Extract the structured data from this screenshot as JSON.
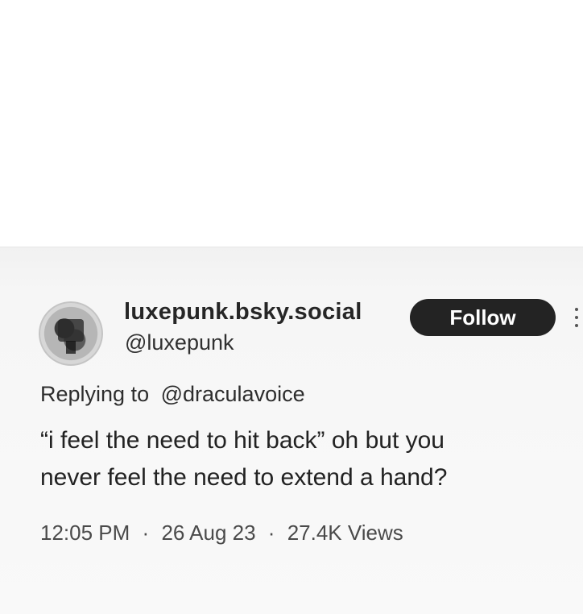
{
  "profile": {
    "display_name": "luxepunk.bsky.social",
    "handle": "@luxepunk",
    "follow_label": "Follow"
  },
  "reply": {
    "prefix": "Replying to",
    "target": "@draculavoice"
  },
  "post": {
    "line1": "“i feel the need to hit back” oh but you",
    "line2": "never feel the need to extend a hand?"
  },
  "meta": {
    "time": "12:05 PM",
    "date": "26 Aug 23",
    "views": "27.4K Views",
    "separator": "·"
  },
  "icons": {
    "avatar": "profile-photo",
    "more": "vertical-dots-icon"
  }
}
